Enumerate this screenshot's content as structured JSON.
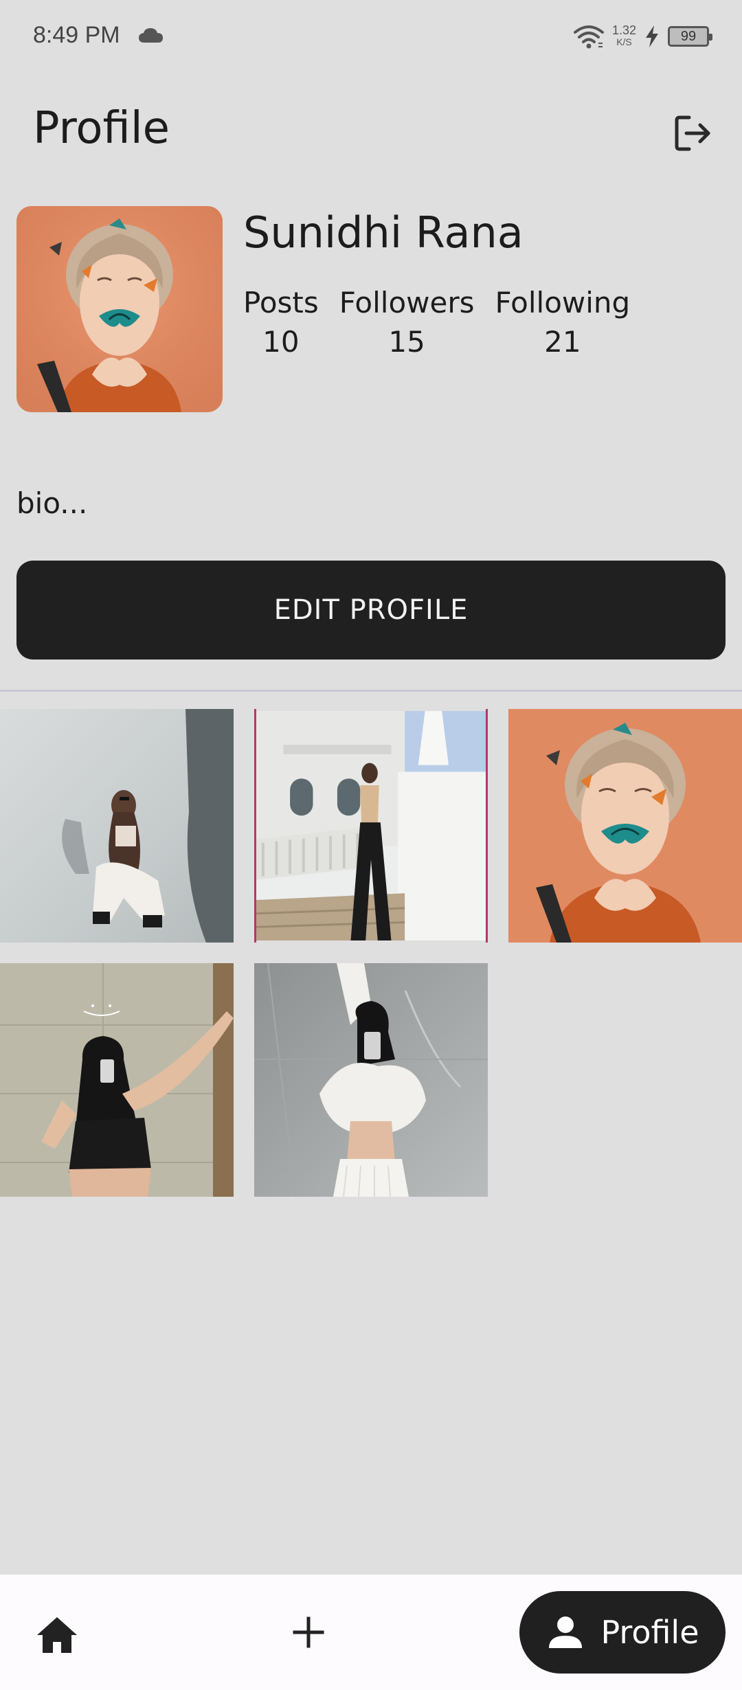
{
  "status_bar": {
    "time": "8:49 PM",
    "network_speed_value": "1.32",
    "network_speed_unit": "K/S",
    "battery_level": "99",
    "icons": [
      "cloud-icon",
      "wifi-icon",
      "charging-bolt-icon",
      "battery-icon"
    ]
  },
  "header": {
    "title": "Profile",
    "logout_icon": "logout-icon"
  },
  "profile": {
    "name": "Sunidhi Rana",
    "stats": [
      {
        "label": "Posts",
        "value": "10"
      },
      {
        "label": "Followers",
        "value": "15"
      },
      {
        "label": "Following",
        "value": "21"
      }
    ],
    "bio": "bio...",
    "edit_button_label": "EDIT PROFILE"
  },
  "posts": [
    {
      "name": "post-1",
      "subject": "woman crouching in white studio"
    },
    {
      "name": "post-2",
      "subject": "woman standing on white staircase"
    },
    {
      "name": "post-3",
      "subject": "woman with butterflies on face, orange background"
    },
    {
      "name": "post-4",
      "subject": "mirror selfie in black outfit"
    },
    {
      "name": "post-5",
      "subject": "mirror selfie in white outfit, marble wall"
    }
  ],
  "bottom_nav": {
    "home_icon": "home-icon",
    "add_icon": "add-icon",
    "profile_icon": "person-icon",
    "profile_label": "Profile"
  },
  "colors": {
    "background": "#dfdfdf",
    "button_dark": "#202020",
    "nav_background": "#fdfbfd",
    "portrait_orange": "#e08a62"
  }
}
